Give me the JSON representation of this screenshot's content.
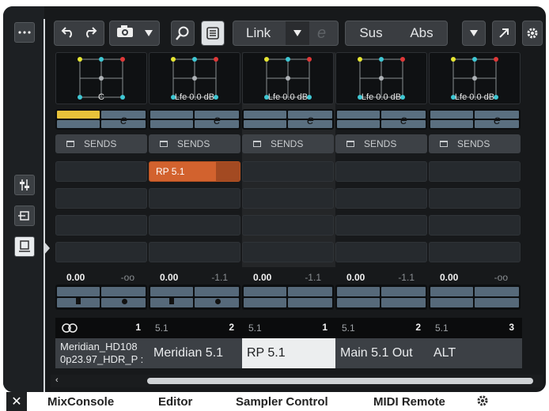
{
  "toolbar": {
    "more_icon": "ellipsis-icon",
    "undo_icon": "undo-icon",
    "redo_icon": "redo-icon",
    "snapshot_icon": "camera-icon",
    "dropdown_icon": "chevron-down-icon",
    "search_icon": "search-icon",
    "list_icon": "list-icon",
    "link_label": "Link",
    "link_e_icon": "e-icon",
    "sus_label": "Sus",
    "abs_label": "Abs",
    "popout_icon": "arrow-up-right-icon",
    "settings_icon": "gear-icon"
  },
  "rail": {
    "items": [
      {
        "name": "fader-icon"
      },
      {
        "name": "routing-icon"
      },
      {
        "name": "display-icon"
      }
    ]
  },
  "channels": [
    {
      "panner_label": "C",
      "format": "",
      "number": "1",
      "name": "Meridian_HD108\n0p23.97_HDR_P :",
      "vol": "0.00",
      "pan": "-oo",
      "send_slot": "",
      "link_icon": "link-rings-icon"
    },
    {
      "panner_label": "Lfe 0.0 dB",
      "format": "5.1",
      "number": "2",
      "name": "Meridian 5.1",
      "vol": "0.00",
      "pan": "-1.1",
      "send_slot": "RP 5.1"
    },
    {
      "panner_label": "Lfe 0.0 dB",
      "format": "5.1",
      "number": "1",
      "name": "RP 5.1",
      "vol": "0.00",
      "pan": "-1.1",
      "send_slot": ""
    },
    {
      "panner_label": "Lfe 0.0 dB",
      "format": "5.1",
      "number": "2",
      "name": "Main 5.1  Out",
      "vol": "0.00",
      "pan": "-1.1",
      "send_slot": ""
    },
    {
      "panner_label": "Lfe 0.0 dB",
      "format": "5.1",
      "number": "3",
      "name": "ALT",
      "vol": "0.00",
      "pan": "-oo",
      "send_slot": ""
    }
  ],
  "sends_label": "SENDS",
  "tabs": {
    "close": "✕",
    "items": [
      "MixConsole",
      "Editor",
      "Sampler Control",
      "MIDI Remote"
    ]
  },
  "colors": {
    "send_active": "#d2622e",
    "selected_name_bg": "#eceeef",
    "bg": "#17191b"
  }
}
